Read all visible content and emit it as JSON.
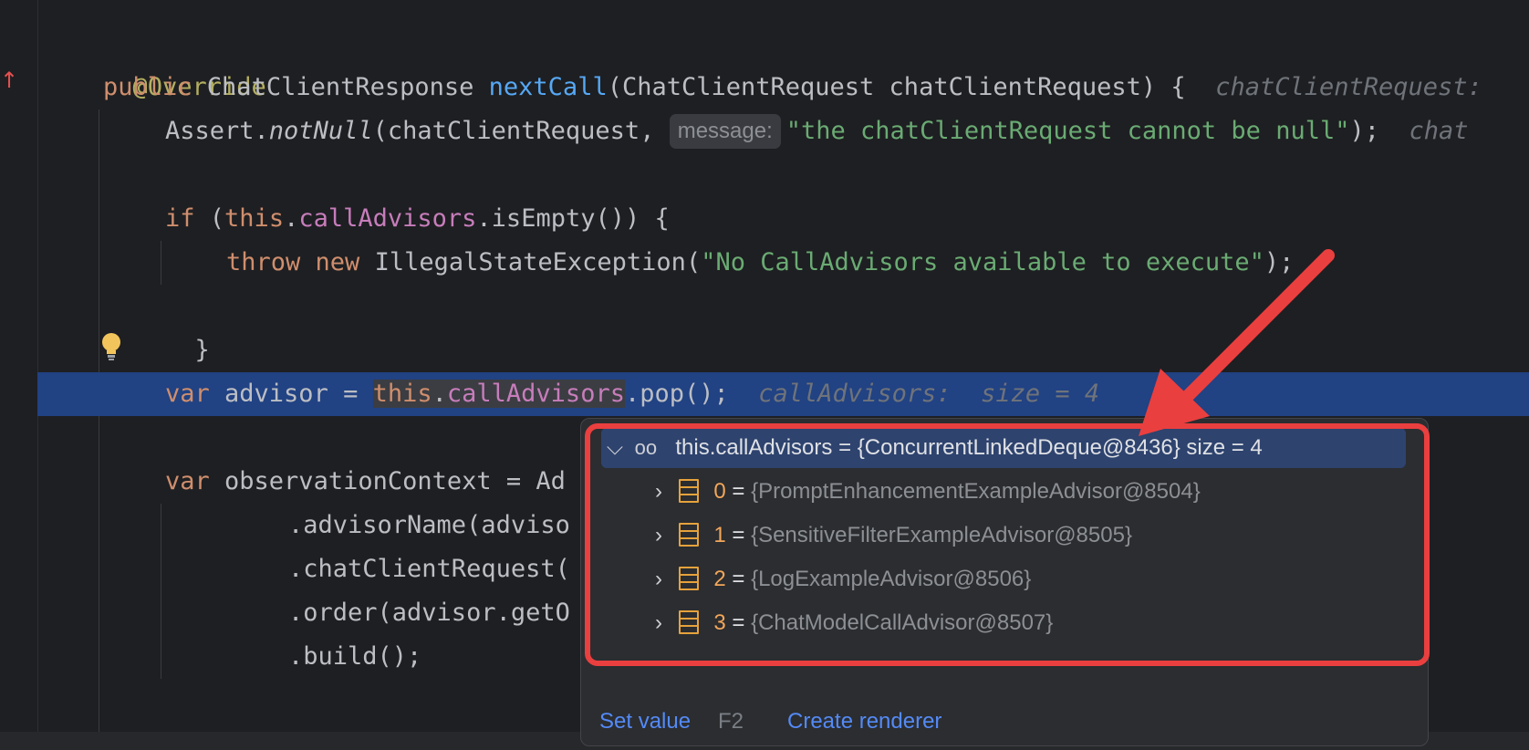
{
  "code": {
    "override": "@Override",
    "l2_public": "public ",
    "l2_rettype": "ChatClientResponse ",
    "l2_method": "nextCall",
    "l2_params": "(ChatClientRequest chatClientRequest) {",
    "l2_inlay": "chatClientRequest:",
    "l3_assert": "Assert.",
    "l3_notnull": "notNull",
    "l3_arg": "(chatClientRequest, ",
    "l3_hint": "message:",
    "l3_str": "\"the chatClientRequest cannot be null\"",
    "l3_end": ");",
    "l3_inlay": "chat",
    "l5_if": "if ",
    "l5_paren": "(",
    "l5_this": "this",
    "l5_dot": ".",
    "l5_field": "callAdvisors",
    "l5_rest": ".isEmpty()) {",
    "l6_throw": "throw ",
    "l6_new": "new ",
    "l6_cls": "IllegalStateException(",
    "l6_str": "\"No CallAdvisors available to execute\"",
    "l6_end": ");",
    "l7_brace": "}",
    "l9_var": "var ",
    "l9_name": "advisor = ",
    "l9_this": "this",
    "l9_dot": ".",
    "l9_field": "callAdvisors",
    "l9_rest": ".pop();",
    "l9_inlay": "callAdvisors:  size = 4",
    "l11_var": "var ",
    "l11_rest": "observationContext = Ad",
    "l12": ".advisorName(adviso",
    "l13": ".chatClientRequest(",
    "l14": ".order(advisor.getO",
    "l15": ".build();"
  },
  "popup": {
    "root_label": "this.callAdvisors = {ConcurrentLinkedDeque@8436}  size = 4",
    "items": [
      {
        "index": "0",
        "eq": " = ",
        "value": "{PromptEnhancementExampleAdvisor@8504}"
      },
      {
        "index": "1",
        "eq": " = ",
        "value": "{SensitiveFilterExampleAdvisor@8505}"
      },
      {
        "index": "2",
        "eq": " = ",
        "value": "{LogExampleAdvisor@8506}"
      },
      {
        "index": "3",
        "eq": " = ",
        "value": "{ChatModelCallAdvisor@8507}"
      }
    ],
    "set_value": "Set value",
    "set_value_key": "F2",
    "create_renderer": "Create renderer"
  },
  "icons": {
    "chevron_down": "⌵",
    "chevron_right": "›",
    "glasses": "oo",
    "up_arrow": "↑"
  },
  "colors": {
    "editor_bg": "#1e1f22",
    "current_line": "#214283",
    "annotation_red": "#ea3f3f"
  }
}
